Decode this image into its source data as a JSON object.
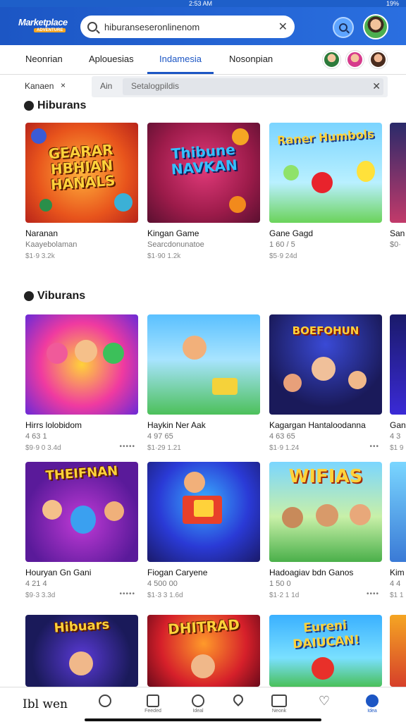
{
  "status": {
    "time": "2:53 AM",
    "battery": "19%"
  },
  "header": {
    "logo_main": "Marketplace",
    "logo_sub": "ADVENTURE",
    "search_value": "hiburanseseronlinenom"
  },
  "tabs": [
    {
      "label": "Neonrian"
    },
    {
      "label": "Aplouesias"
    },
    {
      "label": "Indamesia"
    },
    {
      "label": "Nosonpian"
    }
  ],
  "filter": {
    "label": "Kanaen",
    "tag": "Ain",
    "placeholder": "Setalogpildis"
  },
  "sections": [
    {
      "title": "Hiburans",
      "cards": [
        {
          "art": "GEARAR HBHIAN HANALS",
          "name": "Naranan",
          "sub": "Kaayebolaman",
          "price": "$1·9 3.2k"
        },
        {
          "art": "Thibune NAVKAN",
          "name": "Kingan Game",
          "sub": "Searcdonunatoe",
          "price": "$1·90 1.2k"
        },
        {
          "art": "Raner Humbols",
          "name": "Gane Gagd",
          "sub": "1 60 / 5",
          "price": "$5·9 24d"
        },
        {
          "art": "",
          "name": "San",
          "sub": "$0·",
          "price": ""
        }
      ]
    },
    {
      "title": "Viburans",
      "cards": [
        {
          "art": "",
          "name": "Hirrs lolobidom",
          "sub": "4 63 1",
          "price": "$9·9 0 3.4d",
          "dots": "•••••"
        },
        {
          "art": "",
          "name": "Haykin Ner Aak",
          "sub": "4 97 65",
          "price": "$1·29 1.21",
          "dots": ""
        },
        {
          "art": "BOEFOHUN",
          "name": "Kagargan Hantaloodanna",
          "sub": "4 63 65",
          "price": "$1·9 1.24",
          "dots": "•••"
        },
        {
          "art": "",
          "name": "Gan",
          "sub": "4 3",
          "price": "$1 9",
          "dots": ""
        }
      ]
    },
    {
      "title": "",
      "cards": [
        {
          "art": "THEIFNAN",
          "name": "Houryan Gn Gani",
          "sub": "4 21 4",
          "price": "$9·3 3.3d",
          "dots": "•••••"
        },
        {
          "art": "",
          "name": "Fiogan Caryene",
          "sub": "4 500 00",
          "price": "$1·3 3 1.6d",
          "dots": ""
        },
        {
          "art": "WIFIAS",
          "name": "Hadoagiav bdn Ganos",
          "sub": "1 50 0",
          "price": "$1·2 1 1d",
          "dots": "••••"
        },
        {
          "art": "",
          "name": "Kim",
          "sub": "4 4",
          "price": "$1 1",
          "dots": ""
        }
      ]
    },
    {
      "title": "",
      "cards": [
        {
          "art": "Hibuars",
          "name": "",
          "sub": "",
          "price": ""
        },
        {
          "art": "DHITRAD",
          "name": "",
          "sub": "",
          "price": ""
        },
        {
          "art": "Eureni DAIUCAN!",
          "name": "",
          "sub": "",
          "price": ""
        },
        {
          "art": "",
          "name": "",
          "sub": "",
          "price": ""
        }
      ]
    }
  ],
  "bottom_nav": {
    "brand": "Ibl wen",
    "items": [
      {
        "label": "",
        "icon": "search-icon"
      },
      {
        "label": "Feeded",
        "icon": "home-icon"
      },
      {
        "label": "Ideal",
        "icon": "globe-icon"
      },
      {
        "label": "",
        "icon": "pin-icon"
      },
      {
        "label": "Neonk",
        "icon": "message-icon"
      },
      {
        "label": "",
        "icon": "heart-icon"
      },
      {
        "label": "Idea",
        "icon": "profile-icon"
      }
    ]
  },
  "colors": {
    "brand": "#1c56c4",
    "accent": "#f5a623"
  }
}
